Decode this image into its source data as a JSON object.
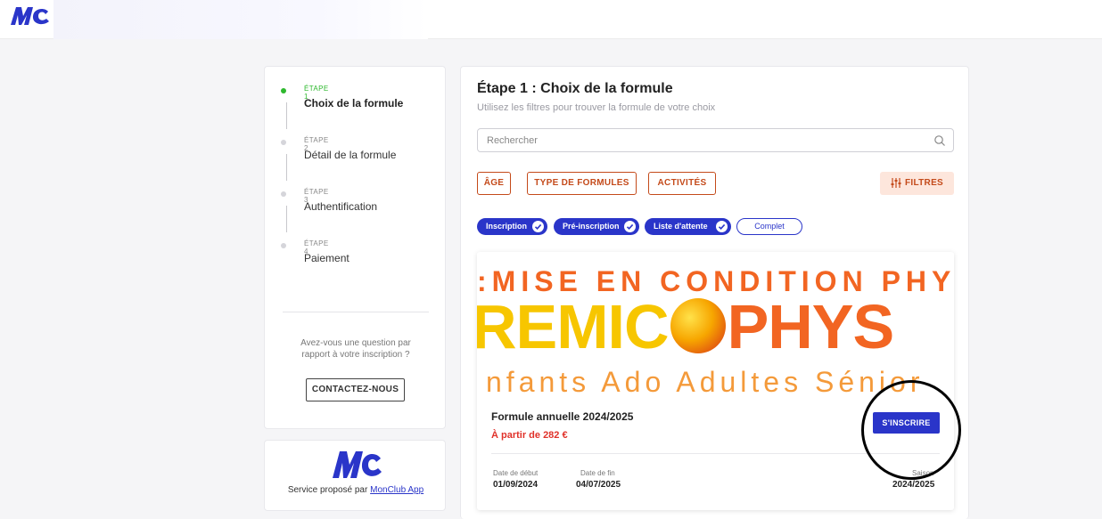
{
  "header": {
    "logo": "MC"
  },
  "steps": [
    {
      "overline": "ÉTAPE 1",
      "title": "Choix de la formule",
      "active": true
    },
    {
      "overline": "ÉTAPE 2",
      "title": "Détail de la formule",
      "active": false
    },
    {
      "overline": "ÉTAPE 3",
      "title": "Authentification",
      "active": false
    },
    {
      "overline": "ÉTAPE 4",
      "title": "Paiement",
      "active": false
    }
  ],
  "help": {
    "question": "Avez-vous une question par rapport à votre inscription ?",
    "contact_label": "CONTACTEZ-NOUS"
  },
  "service": {
    "text": "Service proposé par",
    "link": "MonClub App",
    "logo": "MC"
  },
  "main": {
    "title": "Étape 1 : Choix de la formule",
    "subtitle": "Utilisez les filtres pour trouver la formule de votre choix",
    "search_placeholder": "Rechercher",
    "filters": [
      "ÂGE",
      "TYPE DE FORMULES",
      "ACTIVITÉS"
    ],
    "filtres_label": "FILTRES",
    "chips": [
      {
        "label": "Inscription",
        "selected": true
      },
      {
        "label": "Pré-inscription",
        "selected": true
      },
      {
        "label": "Liste d'attente",
        "selected": true
      },
      {
        "label": "Complet",
        "selected": false
      }
    ]
  },
  "product": {
    "banner_line1": ":MISE EN CONDITION PHYSIQU",
    "banner_line2_a": "REMIC",
    "banner_line2_b": "PHYS",
    "banner_line3": "nfants Ado Adultes Sénior",
    "name": "Formule annuelle 2024/2025",
    "price": "À partir de 282 €",
    "cta": "S'INSCRIRE",
    "start_label": "Date de début",
    "start_value": "01/09/2024",
    "end_label": "Date de fin",
    "end_value": "04/07/2025",
    "season_label": "Saison",
    "season_value": "2024/2025"
  },
  "colors": {
    "brand_blue": "#2a35c9",
    "accent_orange": "#c44a1a",
    "active_green": "#2eb82e",
    "price_red": "#e0322a"
  }
}
